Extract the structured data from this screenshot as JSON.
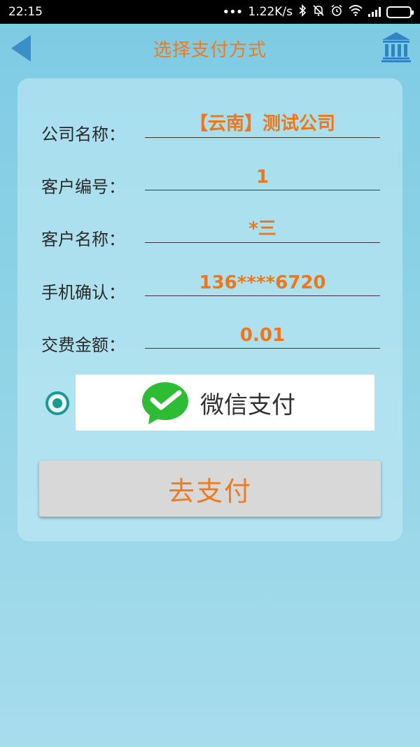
{
  "status_bar": {
    "time": "22:15",
    "network_speed": "1.22K/s",
    "icons": [
      "more-dots-icon",
      "bluetooth-icon",
      "mute-icon",
      "alarm-icon",
      "wifi-icon",
      "signal-icon",
      "battery-icon"
    ]
  },
  "header": {
    "title": "选择支付方式",
    "back_icon": "back-arrow-icon",
    "bank_icon": "bank-icon"
  },
  "form": {
    "fields": [
      {
        "label": "公司名称：",
        "value": "【云南】测试公司"
      },
      {
        "label": "客户编号：",
        "value": "1"
      },
      {
        "label": "客户名称：",
        "value": "*三"
      },
      {
        "label": "手机确认：",
        "value": "136****6720"
      },
      {
        "label": "交费金额：",
        "value": "0.01"
      }
    ]
  },
  "payment": {
    "option_label": "微信支付",
    "selected": true
  },
  "pay_button": {
    "label": "去支付"
  },
  "colors": {
    "accent": "#f07a1e",
    "radio": "#1a9a92",
    "wechat_green": "#2fbc35"
  }
}
